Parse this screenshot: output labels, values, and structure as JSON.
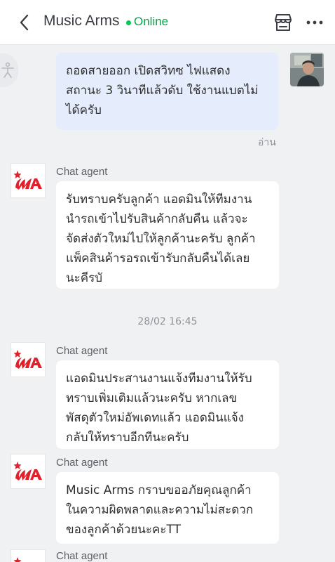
{
  "header": {
    "title": "Music Arms",
    "status": "Online",
    "status_color": "#06c755",
    "icons": [
      "back-chevron-icon",
      "shop-icon",
      "more-icon"
    ]
  },
  "side_button": {
    "icon": "accessibility-icon"
  },
  "messages": [
    {
      "sender": "user",
      "text": "ถอดสายออก  เปิดสวิทซ  ไฟแสดง\nสถานะ 3 วินาทีแล้วดับ  ใช้งานแบตไม่\nได้ครับ",
      "read_label": "อ่าน"
    },
    {
      "sender": "Chat agent",
      "text": "รับทราบครับลูกค้า แอดมินให้ทีมงาน\nนำรถเข้าไปรับสินค้ากลับคืน แล้วจะ\nจัดส่งตัวใหม่ไปให้ลูกค้านะครับ ลูกค้า\nแพ็คสินค้ารอรถเข้ารับกลับคืนได้เลย\nนะคีรบั"
    },
    {
      "sender": "Chat agent",
      "text": "แอดมินประสานงานแจ้งทีมงานให้รับ\nทราบเพิ่มเติมแล้วนะครับ  หากเลข\nพัสดุตัวใหม่อัพเดทแล้ว แอดมินแจ้ง\nกลับให้ทราบอีกทีนะครับ"
    },
    {
      "sender": "Chat agent",
      "text": "Music Arms กราบขออภัยคุณลูกค้า\nในความผิดพลาดและความไม่สะดวก\nของลูกค้าด้วยนะคะTT"
    },
    {
      "sender": "Chat agent",
      "text": ""
    }
  ],
  "date_separator": "28/02 16:45",
  "colors": {
    "outgoing_bubble": "#e5ecfb",
    "incoming_bubble": "#ffffff",
    "background": "#f0f1f3",
    "logo_red": "#e0202a"
  }
}
